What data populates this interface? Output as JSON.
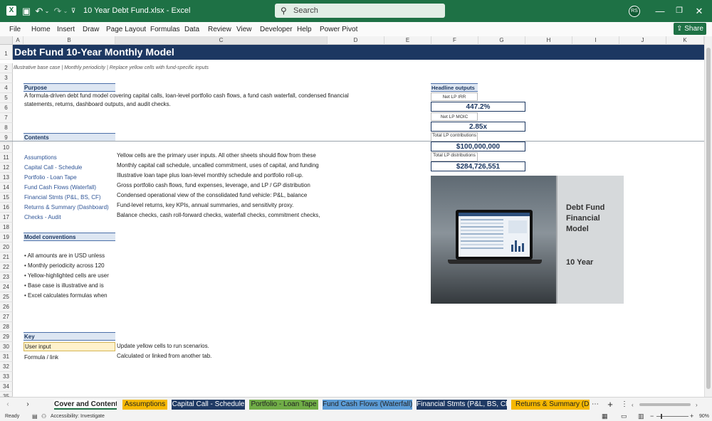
{
  "window": {
    "doc_title": "10 Year Debt Fund.xlsx  -  Excel",
    "search_placeholder": "Search",
    "avatar": "RS",
    "share": "Share"
  },
  "menu": [
    "File",
    "Home",
    "Insert",
    "Draw",
    "Page Layout",
    "Formulas",
    "Data",
    "Review",
    "View",
    "Developer",
    "Help",
    "Power Pivot"
  ],
  "columns": [
    "A",
    "B",
    "C",
    "D",
    "E",
    "F",
    "G",
    "H",
    "I",
    "J",
    "K"
  ],
  "rows": [
    "1",
    "2",
    "3",
    "4",
    "5",
    "6",
    "7",
    "8",
    "9",
    "10",
    "11",
    "12",
    "13",
    "14",
    "15",
    "16",
    "17",
    "18",
    "19",
    "20",
    "21",
    "22",
    "23",
    "24",
    "25",
    "26",
    "27",
    "28",
    "29",
    "30",
    "31",
    "32",
    "33",
    "34",
    "35"
  ],
  "sheet": {
    "title": "Debt Fund 10-Year Monthly Model",
    "subtitle": "Illustrative base case | Monthly periodicity | Replace yellow cells with fund-specific inputs",
    "purpose_header": "Purpose",
    "purpose_line1": "A formula-driven debt fund model covering capital calls, loan-level portfolio cash flows, a fund cash waterfall, condensed financial",
    "purpose_line2": "statements, returns, dashboard outputs, and audit checks.",
    "contents_header": "Contents",
    "contents": [
      {
        "name": "Assumptions",
        "desc": "Yellow cells are the primary user inputs. All other sheets should flow from these"
      },
      {
        "name": "Capital Call - Schedule",
        "desc": "Monthly capital call schedule, uncalled commitment, uses of capital, and funding"
      },
      {
        "name": "Portfolio - Loan Tape",
        "desc": "Illustrative loan tape plus loan-level monthly schedule and portfolio roll-up."
      },
      {
        "name": "Fund Cash Flows (Waterfall)",
        "desc": "Gross portfolio cash flows, fund expenses, leverage, and LP / GP distribution"
      },
      {
        "name": "Financial Stmts (P&L, BS, CF)",
        "desc": "Condensed operational view of the consolidated fund vehicle: P&L, balance"
      },
      {
        "name": "Returns & Summary (Dashboard)",
        "desc": "Fund-level returns, key KPIs, annual summaries, and sensitivity proxy."
      },
      {
        "name": "Checks - Audit",
        "desc": "Balance checks, cash roll-forward checks, waterfall checks, commitment checks,"
      }
    ],
    "conventions_header": "Model conventions",
    "conventions": [
      "• All amounts are in USD unless",
      "• Monthly periodicity across 120",
      "• Yellow-highlighted cells are user",
      "• Base case is illustrative and is",
      "• Excel calculates formulas when"
    ],
    "key_header": "Key",
    "key_items": [
      {
        "label": "User input",
        "desc": "Update yellow cells to run scenarios."
      },
      {
        "label": "Formula / link",
        "desc": "Calculated or linked from another tab."
      }
    ],
    "outputs_header": "Headline outputs",
    "outputs": [
      {
        "label": "Net LP IRR",
        "value": "447.2%"
      },
      {
        "label": "Net LP MOIC",
        "value": "2.85x"
      },
      {
        "label": "Total LP contributions",
        "value": "$100,000,000"
      },
      {
        "label": "Total LP distributions",
        "value": "$284,726,551"
      }
    ],
    "image_text": {
      "line1": "Debt Fund",
      "line2": "Financial",
      "line3": "Model",
      "line4": "10 Year"
    }
  },
  "tabs": [
    {
      "label": "Cover and Contents",
      "color": "#ffffff"
    },
    {
      "label": "Assumptions",
      "color": "#f5b800"
    },
    {
      "label": "Capital Call - Schedule",
      "color": "#1f3a64"
    },
    {
      "label": "Portfolio - Loan Tape",
      "color": "#70ad47"
    },
    {
      "label": "Fund Cash Flows (Waterfall)",
      "color": "#5b9bd5"
    },
    {
      "label": "Financial Stmts (P&L, BS, CF)",
      "color": "#1f3a64"
    },
    {
      "label": "Returns & Summary (Das",
      "color": "#f5b800"
    }
  ],
  "status": {
    "ready": "Ready",
    "accessibility": "Accessibility: Investigate",
    "zoom": "90%"
  }
}
